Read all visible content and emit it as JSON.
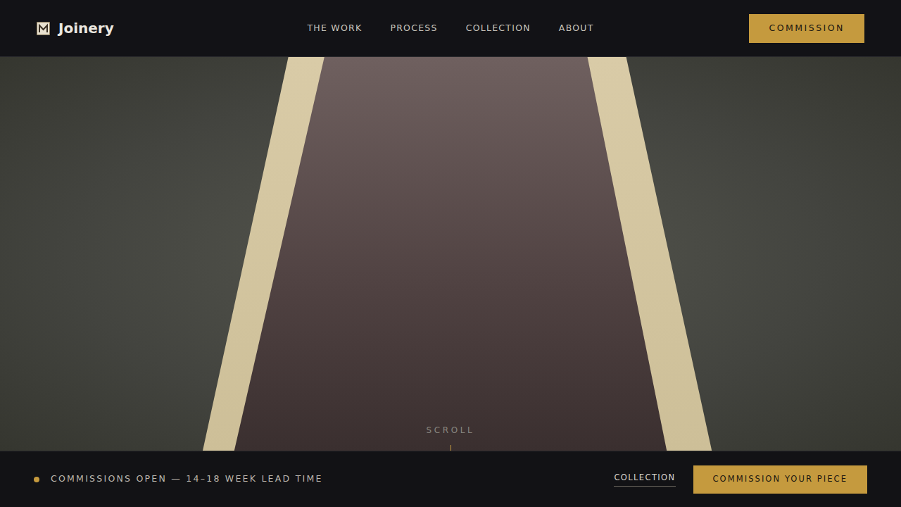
{
  "header": {
    "brand": "Joinery",
    "nav": [
      {
        "label": "THE WORK",
        "selected": false
      },
      {
        "label": "PROCESS",
        "selected": false
      },
      {
        "label": "COLLECTION",
        "selected": false
      },
      {
        "label": "ABOUT",
        "selected": false
      }
    ],
    "cta": "COMMISSION"
  },
  "hero": {
    "scroll_label": "SCROLL"
  },
  "footer_bar": {
    "status": "COMMISSIONS OPEN — 14–18 WEEK LEAD TIME",
    "link": "COLLECTION",
    "cta": "COMMISSION YOUR PIECE"
  }
}
